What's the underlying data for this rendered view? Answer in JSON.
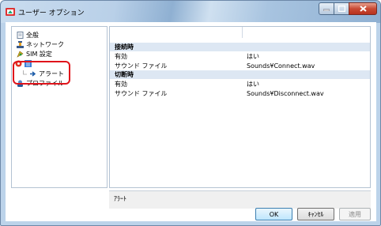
{
  "window": {
    "title": "ユーザー オプション"
  },
  "tree": {
    "items": [
      {
        "label": "全般",
        "icon": "page-icon"
      },
      {
        "label": "ネットワーク",
        "icon": "network-icon"
      },
      {
        "label": "SIM 設定",
        "icon": "sim-icon"
      },
      {
        "label": "",
        "icon": "highlighted-folder-icon"
      },
      {
        "label": "アラート",
        "icon": "arrow-icon"
      },
      {
        "label": "プロファイル",
        "icon": "profile-icon"
      }
    ]
  },
  "properties": {
    "sections": [
      {
        "header": "接続時",
        "rows": [
          {
            "name": "有効",
            "value": "はい"
          },
          {
            "name": "サウンド ファイル",
            "value": "Sounds¥Connect.wav"
          }
        ]
      },
      {
        "header": "切断時",
        "rows": [
          {
            "name": "有効",
            "value": "はい"
          },
          {
            "name": "サウンド ファイル",
            "value": "Sounds¥Disconnect.wav"
          }
        ]
      }
    ]
  },
  "description": "ｱﾗｰﾄ",
  "buttons": {
    "ok": "OK",
    "cancel": "ｷｬﾝｾﾙ",
    "apply": "適用"
  },
  "colors": {
    "highlight_box": "#e0141b",
    "category_bg": "#dde7f3",
    "close_button": "#c94a34"
  }
}
